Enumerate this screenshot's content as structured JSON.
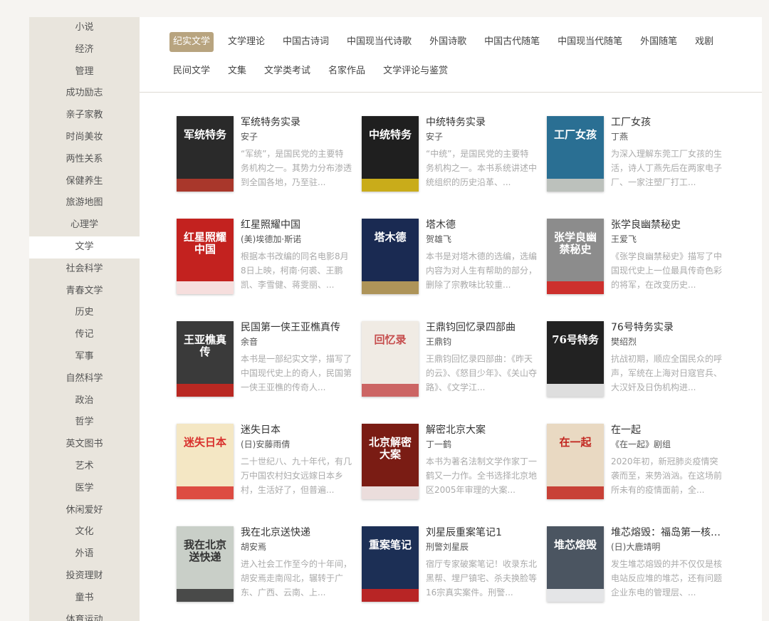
{
  "sidebar": {
    "items": [
      "小说",
      "经济",
      "管理",
      "成功励志",
      "亲子家教",
      "时尚美妆",
      "两性关系",
      "保健养生",
      "旅游地图",
      "心理学",
      "文学",
      "社会科学",
      "青春文学",
      "历史",
      "传记",
      "军事",
      "自然科学",
      "政治",
      "哲学",
      "英文图书",
      "艺术",
      "医学",
      "休闲爱好",
      "文化",
      "外语",
      "投资理财",
      "童书",
      "体育运动"
    ],
    "active": "文学"
  },
  "categories": {
    "row1": [
      "纪实文学",
      "文学理论",
      "中国古诗词",
      "中国现当代诗歌",
      "外国诗歌",
      "中国古代随笔",
      "中国现当代随笔",
      "外国随笔",
      "戏剧"
    ],
    "row2": [
      "民间文学",
      "文集",
      "文学类考试",
      "名家作品",
      "文学评论与鉴赏"
    ],
    "active": "纪实文学"
  },
  "books": [
    {
      "title": "军统特务实录",
      "author": "安子",
      "desc": "“军统”，是国民党的主要特务机构之一。其势力分布渗透到全国各地，乃至驻...",
      "cover_text": "军统特务",
      "cover_color": "#2a2a2a",
      "accent": "#c0392b"
    },
    {
      "title": "中统特务实录",
      "author": "安子",
      "desc": "“中统”，是国民党的主要特务机构之一。本书系统讲述中统组织的历史沿革、...",
      "cover_text": "中统特务",
      "cover_color": "#1f1f1f",
      "accent": "#e8c51a"
    },
    {
      "title": "工厂女孩",
      "author": "丁燕",
      "desc": "为深入理解东莞工厂女孩的生活，诗人丁燕先后在两家电子厂、一家注塑厂打工...",
      "cover_text": "工厂女孩",
      "cover_color": "#2a6f93",
      "accent": "#d6d0c3"
    },
    {
      "title": "红星照耀中国",
      "author": "(美)埃德加·斯诺",
      "desc": "根据本书改编的同名电影8月8日上映，柯南·何裘、王鹏凯、李雪健、蒋雯丽、...",
      "cover_text": "红星照耀中国",
      "cover_color": "#c3221f",
      "accent": "#ffffff"
    },
    {
      "title": "塔木德",
      "author": "贺雄飞",
      "desc": "本书是对塔木德的选编，选编内容为对人生有帮助的部分，删除了宗教味比较重...",
      "cover_text": "塔木德",
      "cover_color": "#1a2a52",
      "accent": "#c9a75a"
    },
    {
      "title": "张学良幽禁秘史",
      "author": "王爱飞",
      "desc": "《张学良幽禁秘史》描写了中国现代史上一位最具传奇色彩的将军，在改变历史...",
      "cover_text": "张学良幽禁秘史",
      "cover_color": "#8c8c8c",
      "accent": "#d8201c"
    },
    {
      "title": "民国第一侠王亚樵真传",
      "author": "余音",
      "desc": "本书是一部纪实文学，描写了中国现代史上的奇人，民国第一侠王亚樵的传奇人...",
      "cover_text": "王亚樵真传",
      "cover_color": "#3a3a3a",
      "accent": "#d0261f"
    },
    {
      "title": "王鼎钧回忆录四部曲",
      "author": "王鼎钧",
      "desc": "王鼎钧回忆录四部曲：《昨天的云》、《怒目少年》、《关山夺路》、《文学江...",
      "cover_text": "回忆录",
      "cover_color": "#f0ebe4",
      "accent": "#c64d4d"
    },
    {
      "title": "76号特务实录",
      "author": "樊绍烈",
      "desc": "抗战初期，顺应全国民众的呼声，军统在上海对日寇官兵、大汉奸及日伪机构进...",
      "cover_text": "76号特务",
      "cover_color": "#222222",
      "accent": "#ffffff"
    },
    {
      "title": "迷失日本",
      "author": "(日)安藤雨倩",
      "desc": "二十世纪八、九十年代，有几万中国农村妇女远嫁日本乡村，生活好了，但普遍...",
      "cover_text": "迷失日本",
      "cover_color": "#f4e7c4",
      "accent": "#d8302c"
    },
    {
      "title": "解密北京大案",
      "author": "丁一鹤",
      "desc": "本书为著名法制文学作家丁一鹤又一力作。全书选择北京地区2005年审理的大案...",
      "cover_text": "北京解密大案",
      "cover_color": "#7a1c14",
      "accent": "#ffffff"
    },
    {
      "title": "在一起",
      "author": "《在一起》剧组",
      "desc": "2020年初，新冠肺炎疫情突袭而至，来势汹汹。在这场前所未有的疫情面前，全...",
      "cover_text": "在一起",
      "cover_color": "#e9d9c2",
      "accent": "#c2261f"
    },
    {
      "title": "我在北京送快递",
      "author": "胡安焉",
      "desc": "进入社会工作至今的十年间，胡安焉走南闯北，辗转于广东、广西、云南、上...",
      "cover_text": "我在北京送快递",
      "cover_color": "#c9cfc8",
      "accent": "#333333"
    },
    {
      "title": "刘星辰重案笔记1",
      "author": "刑警刘星辰",
      "desc": "宿厅专家破案笔记！收录东北黑帮、埋尸镇宅、杀夫换脸等16宗真实案件。刑警...",
      "cover_text": "重案笔记",
      "cover_color": "#1c2f55",
      "accent": "#d4231d"
    },
    {
      "title": "堆芯熔毁：福岛第一核电站",
      "author": "(日)大鹿靖明",
      "desc": "发生堆芯熔毁的并不仅仅是核电站反应堆的堆芯，还有问题企业东电的管理层、...",
      "cover_text": "堆芯熔毁",
      "cover_color": "#4b5561",
      "accent": "#ffffff"
    }
  ]
}
